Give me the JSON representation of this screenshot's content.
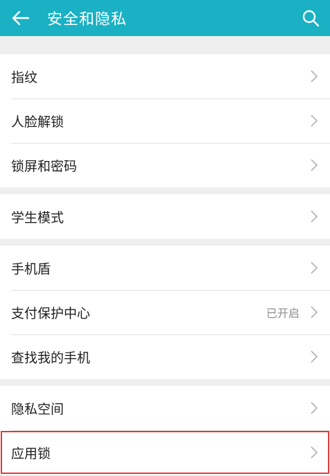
{
  "header": {
    "title": "安全和隐私"
  },
  "sections": [
    {
      "items": [
        {
          "label": "指纹",
          "value": ""
        },
        {
          "label": "人脸解锁",
          "value": ""
        },
        {
          "label": "锁屏和密码",
          "value": ""
        }
      ]
    },
    {
      "items": [
        {
          "label": "学生模式",
          "value": ""
        }
      ]
    },
    {
      "items": [
        {
          "label": "手机盾",
          "value": ""
        },
        {
          "label": "支付保护中心",
          "value": "已开启"
        },
        {
          "label": "查找我的手机",
          "value": ""
        }
      ]
    },
    {
      "items": [
        {
          "label": "隐私空间",
          "value": ""
        },
        {
          "label": "应用锁",
          "value": ""
        }
      ]
    }
  ],
  "colors": {
    "toolbar": "#1ab1c4",
    "highlight_border": "#e03a3a",
    "background": "#efefef"
  },
  "icons": {
    "back": "arrow-left-icon",
    "search": "search-icon",
    "chevron": "chevron-right-icon"
  }
}
